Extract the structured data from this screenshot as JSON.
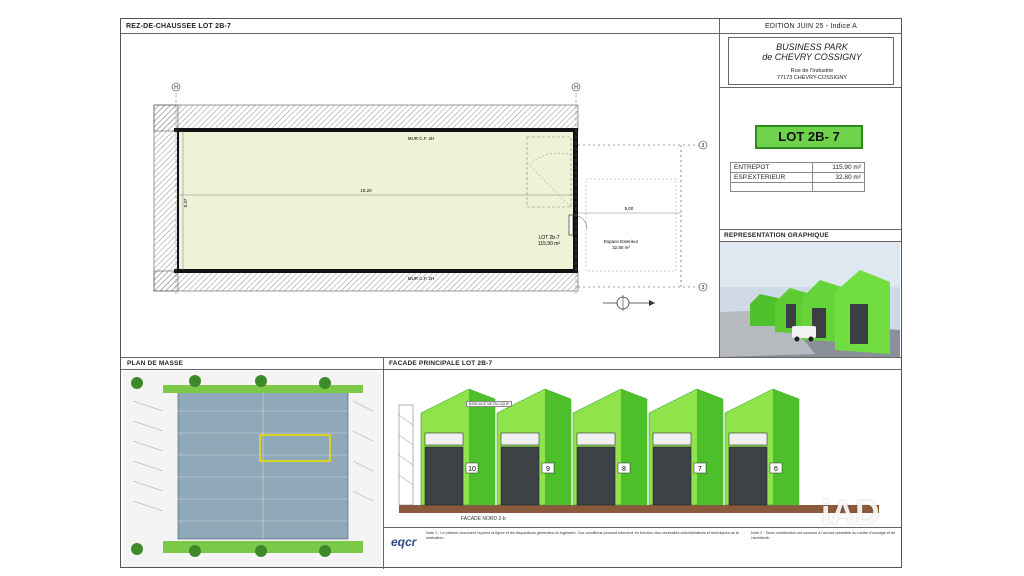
{
  "sheet": {
    "ground_floor_title": "REZ-DE-CHAUSSEE LOT 2B-7",
    "edition": "EDITION JUIN 25 - Indice A",
    "project_name_line1": "BUSINESS PARK",
    "project_name_line2": "de CHEVRY COSSIGNY",
    "address_line1": "Rue de l'Industrie",
    "address_line2": "77173 CHEVRY-COSSIGNY"
  },
  "plan": {
    "wall_top": "MUR C.F. 2H",
    "wall_bottom": "MUR C.F. 2H",
    "length": "18,20",
    "width": "6,37",
    "lot_label": "LOT 2b-7",
    "lot_area": "115,90 m²",
    "exterior_label": "Espace Exterieur",
    "exterior_area": "32,80 m²",
    "exterior_length": "5,00",
    "grid_top": "3",
    "grid_bottom": "3",
    "axis_left": "H",
    "axis_right": "H"
  },
  "lot": {
    "title": "LOT 2B- 7",
    "title_color": "#6ed34a",
    "rows": [
      {
        "label": "ENTREPOT",
        "value": "115.90 m²"
      },
      {
        "label": "ESP.EXTERIEUR",
        "value": "32.80 m²"
      },
      {
        "label": "",
        "value": ""
      }
    ]
  },
  "rep": {
    "title": "REPRESENTATION GRAPHIQUE"
  },
  "masse": {
    "title": "PLAN DE MASSE"
  },
  "facade": {
    "title": "FACADE PRINCIPALE LOT 2B-7",
    "caption": "FACADE NORD 2-b",
    "units": [
      "10",
      "9",
      "8",
      "7",
      "6"
    ],
    "green_light": "#8fe34b",
    "green_dark": "#4cbf2a",
    "callout": "BARDAGE METALLIQUE"
  },
  "footer": {
    "logo": "eqcr",
    "note_left": "Note 1 : Le présent document reprend la figure et les dispositions générales du logement. Ces conditions peuvent intervenir en fonction des nécessités administratives et techniques de la réalisation.",
    "note_right": "Note 2 : Toute modification est soumise à l'accord préalable du maître d'ouvrage et de l'architecte."
  },
  "watermark": "iAD"
}
